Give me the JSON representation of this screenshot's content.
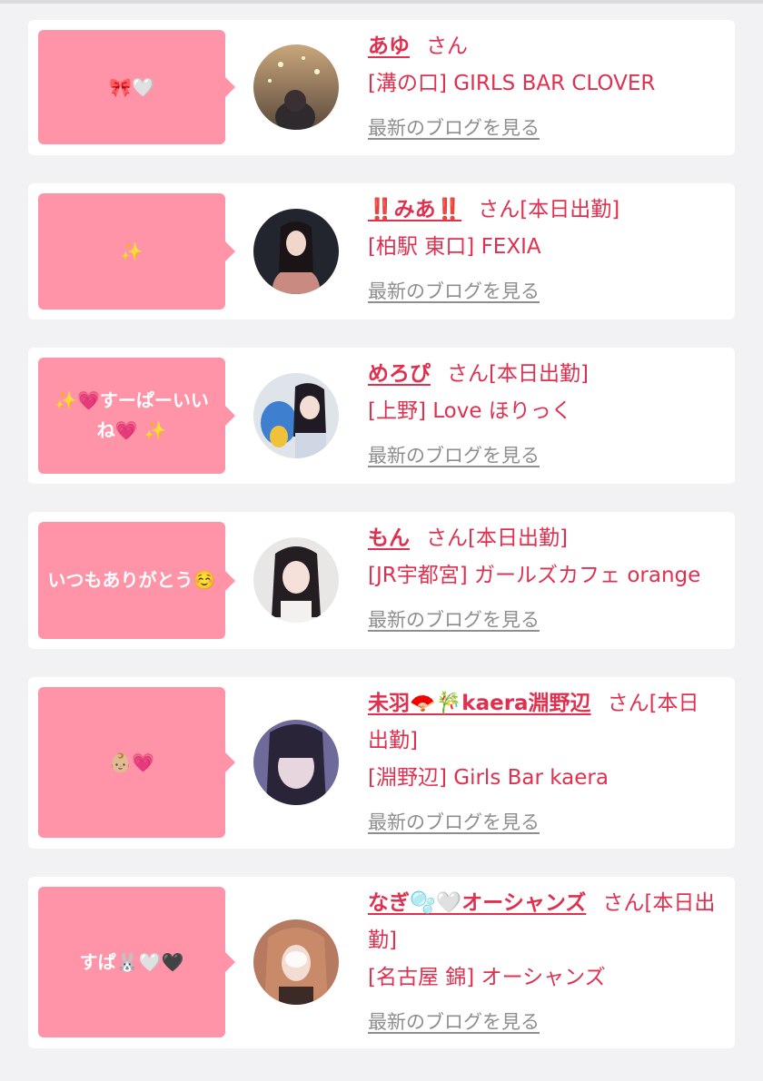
{
  "colors": {
    "accent": "#e0304f",
    "bubble": "#ff93a7",
    "link_gray": "#8e8e8e",
    "card_bg": "#ffffff",
    "page_bg": "#f2f2f4"
  },
  "san_label": "さん",
  "blog_link_label": "最新のブログを見る",
  "cards": [
    {
      "message": "🎀🤍",
      "name": "あゆ",
      "status": "",
      "shop": "[溝の口] GIRLS BAR CLOVER",
      "avatar_icon": "profile-photo"
    },
    {
      "message": "✨",
      "name": "‼️みあ‼️",
      "status": "[本日出勤]",
      "shop": "[柏駅 東口] FEXIA",
      "avatar_icon": "profile-photo"
    },
    {
      "message": "✨💗すーぱーいいね💗 ✨",
      "name": "めろぴ",
      "status": "[本日出勤]",
      "shop": "[上野] Love ほりっく",
      "avatar_icon": "profile-photo"
    },
    {
      "message": "いつもありがとう☺️",
      "name": "もん",
      "status": "[本日出勤]",
      "shop": "[JR宇都宮] ガールズカフェ orange",
      "avatar_icon": "profile-photo"
    },
    {
      "message": "👶🏼💗",
      "name": "未羽🪭🎋kaera淵野辺",
      "status": "[本日出勤]",
      "shop": "[淵野辺] Girls Bar kaera",
      "avatar_icon": "profile-photo"
    },
    {
      "message": "すぱ🐰🤍🖤",
      "name": "なぎ🫧🤍オーシャンズ",
      "status": "[本日出勤]",
      "shop": "[名古屋 錦] オーシャンズ",
      "avatar_icon": "profile-photo"
    }
  ]
}
